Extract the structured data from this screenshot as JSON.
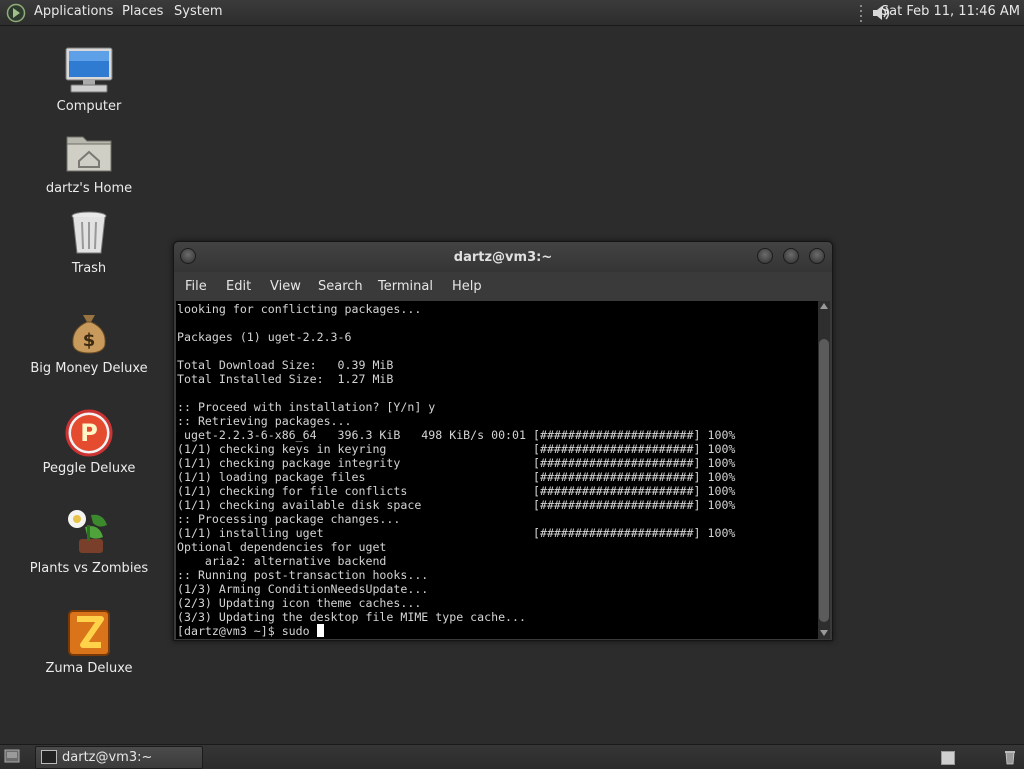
{
  "top_panel": {
    "menus": [
      "Applications",
      "Places",
      "System"
    ],
    "clock": "Sat Feb 11, 11:46 AM",
    "icons": [
      "distro-logo-icon",
      "volume-icon"
    ]
  },
  "desktop": {
    "icons": [
      {
        "label": "Computer",
        "icon": "computer-icon"
      },
      {
        "label": "dartz's Home",
        "icon": "home-folder-icon"
      },
      {
        "label": "Trash",
        "icon": "trash-icon"
      },
      {
        "label": "Big Money Deluxe",
        "icon": "money-bag-icon"
      },
      {
        "label": "Peggle Deluxe",
        "icon": "peggle-icon"
      },
      {
        "label": "Plants vs Zombies",
        "icon": "plants-vs-zombies-icon"
      },
      {
        "label": "Zuma Deluxe",
        "icon": "zuma-icon"
      }
    ]
  },
  "terminal": {
    "title": "dartz@vm3:~",
    "menus": [
      "File",
      "Edit",
      "View",
      "Search",
      "Terminal",
      "Help"
    ],
    "lines": [
      "looking for conflicting packages...",
      "",
      "Packages (1) uget-2.2.3-6",
      "",
      "Total Download Size:   0.39 MiB",
      "Total Installed Size:  1.27 MiB",
      "",
      ":: Proceed with installation? [Y/n] y",
      ":: Retrieving packages...",
      " uget-2.2.3-6-x86_64   396.3 KiB   498 KiB/s 00:01 [######################] 100%",
      "(1/1) checking keys in keyring                     [######################] 100%",
      "(1/1) checking package integrity                   [######################] 100%",
      "(1/1) loading package files                        [######################] 100%",
      "(1/1) checking for file conflicts                  [######################] 100%",
      "(1/1) checking available disk space                [######################] 100%",
      ":: Processing package changes...",
      "(1/1) installing uget                              [######################] 100%",
      "Optional dependencies for uget",
      "    aria2: alternative backend",
      ":: Running post-transaction hooks...",
      "(1/3) Arming ConditionNeedsUpdate...",
      "(2/3) Updating icon theme caches...",
      "(3/3) Updating the desktop file MIME type cache..."
    ],
    "prompt": "[dartz@vm3 ~]$ sudo "
  },
  "bottom_panel": {
    "task_label": "dartz@vm3:~",
    "icons": [
      "show-desktop-icon",
      "terminal-icon",
      "workspace-icon",
      "trash-applet-icon"
    ]
  },
  "colors": {
    "desktop": "#2b2c2b",
    "terminal_bg": "#000000",
    "terminal_fg": "#d4d4d4"
  }
}
